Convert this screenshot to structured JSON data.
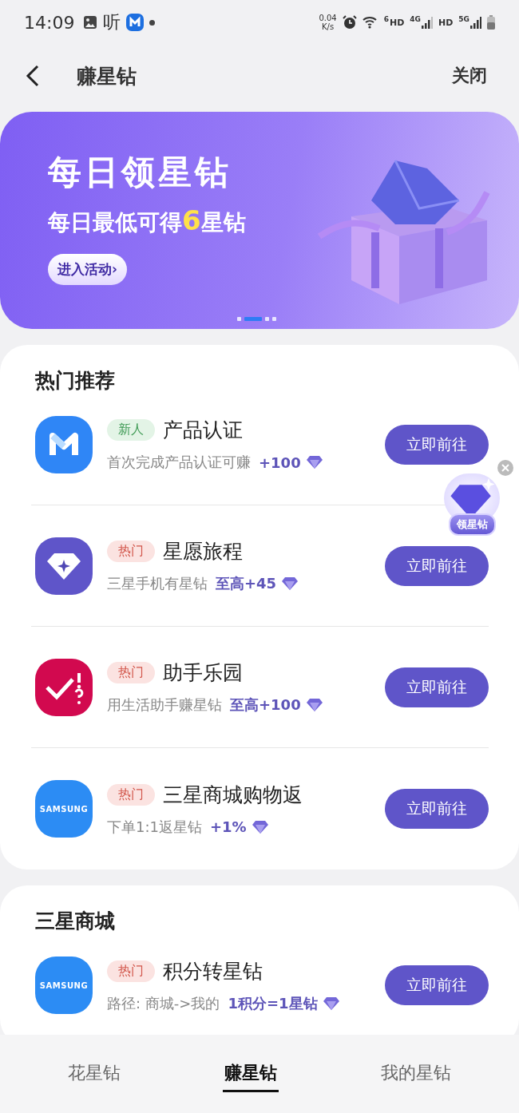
{
  "status_bar": {
    "time": "14:09",
    "app_glyph": "听",
    "speed_value": "0.04",
    "speed_unit": "K/s",
    "wifi_badge": "6",
    "hd_1": "HD",
    "net_1": "4G",
    "hd_2": "HD",
    "net_2": "5G"
  },
  "header": {
    "title": "赚星钻",
    "close": "关闭"
  },
  "banner": {
    "title": "每日领星钻",
    "subtitle_before": "每日最低可得",
    "subtitle_highlight": "6",
    "subtitle_after": "星钻",
    "button": "进入活动›",
    "dots": [
      {
        "selected": false
      },
      {
        "selected": true
      },
      {
        "selected": false
      },
      {
        "selected": false
      }
    ]
  },
  "sections": [
    {
      "title": "热门推荐",
      "items": [
        {
          "kind": "m",
          "badge": {
            "text": "新人",
            "kind": "new"
          },
          "name": "产品认证",
          "desc": "首次完成产品认证可赚",
          "reward": "+100",
          "button": "立即前往"
        },
        {
          "kind": "diamond",
          "badge": {
            "text": "热门",
            "kind": "hot"
          },
          "name": "星愿旅程",
          "desc": "三星手机有星钻",
          "reward": "至高+45",
          "button": "立即前往"
        },
        {
          "kind": "check",
          "badge": {
            "text": "热门",
            "kind": "hot"
          },
          "name": "助手乐园",
          "desc": "用生活助手赚星钻",
          "reward": "至高+100",
          "button": "立即前往"
        },
        {
          "kind": "samsung",
          "icon_text": "SAMSUNG",
          "badge": {
            "text": "热门",
            "kind": "hot"
          },
          "name": "三星商城购物返",
          "desc": "下单1:1返星钻",
          "reward": "+1%",
          "button": "立即前往"
        }
      ]
    },
    {
      "title": "三星商城",
      "items": [
        {
          "kind": "samsung",
          "icon_text": "SAMSUNG",
          "badge": {
            "text": "热门",
            "kind": "hot"
          },
          "name": "积分转星钻",
          "desc": "路径: 商城->我的",
          "reward": "1积分=1星钻",
          "button": "立即前往"
        }
      ]
    }
  ],
  "floating_widget": {
    "label": "领星钻"
  },
  "bottom_tabs": [
    {
      "label": "花星钻",
      "selected": false
    },
    {
      "label": "赚星钻",
      "selected": true
    },
    {
      "label": "我的星钻",
      "selected": false
    }
  ]
}
